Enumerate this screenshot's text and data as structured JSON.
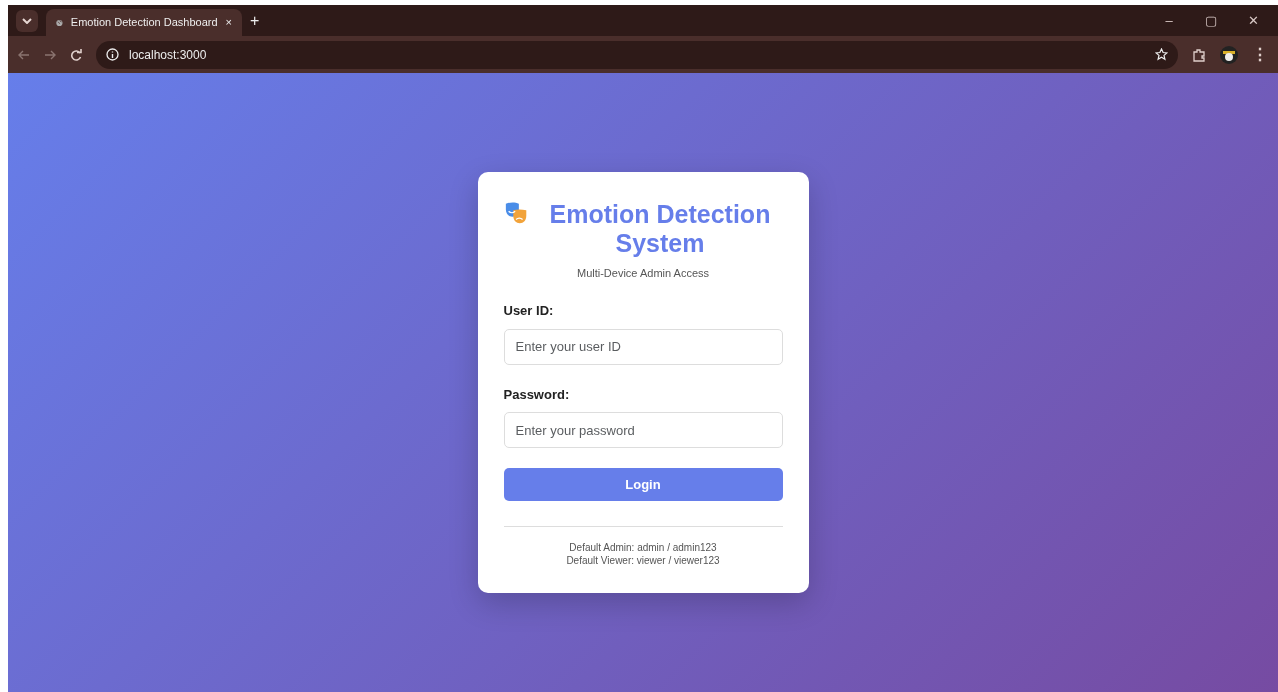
{
  "browser": {
    "tab_title": "Emotion Detection Dashboard",
    "tab_close": "×",
    "new_tab": "+",
    "address": "localhost:3000",
    "window_controls": [
      "–",
      "▢",
      "✕"
    ],
    "menu": "⋮"
  },
  "login": {
    "title": "Emotion Detection System",
    "subtitle": "Multi-Device Admin Access",
    "fields": [
      {
        "label": "User ID:",
        "placeholder": "Enter your user ID"
      },
      {
        "label": "Password:",
        "placeholder": "Enter your password"
      }
    ],
    "button": "Login",
    "hints": [
      "Default Admin: admin / admin123",
      "Default Viewer: viewer / viewer123"
    ]
  }
}
